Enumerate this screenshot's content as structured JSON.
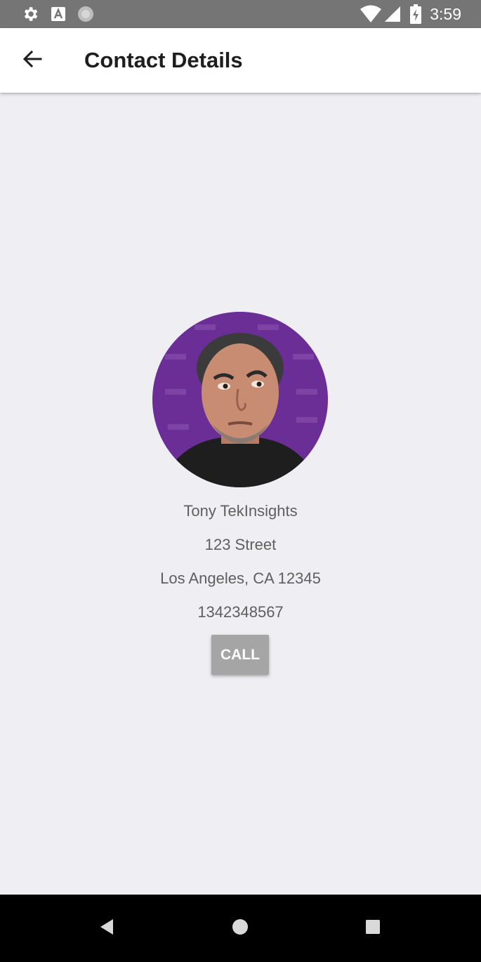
{
  "status_bar": {
    "time": "3:59",
    "icons": [
      "gear-icon",
      "a-letter-icon",
      "circle-icon",
      "wifi-icon",
      "signal-icon",
      "battery-charging-icon"
    ]
  },
  "app_bar": {
    "title": "Contact Details",
    "back_icon": "arrow-left-icon"
  },
  "contact": {
    "name": "Tony TekInsights",
    "street": "123 Street",
    "city_line": "Los Angeles, CA 12345",
    "phone": "1342348567",
    "avatar_background": "#6a2e96"
  },
  "actions": {
    "call_label": "CALL"
  },
  "nav_bar": {
    "icons": [
      "back-triangle-icon",
      "home-circle-icon",
      "recents-square-icon"
    ]
  },
  "colors": {
    "status_bar": "#757575",
    "app_bar": "#ffffff",
    "background": "#efeef3",
    "button": "#a5a5a5",
    "nav_bar": "#000000"
  }
}
